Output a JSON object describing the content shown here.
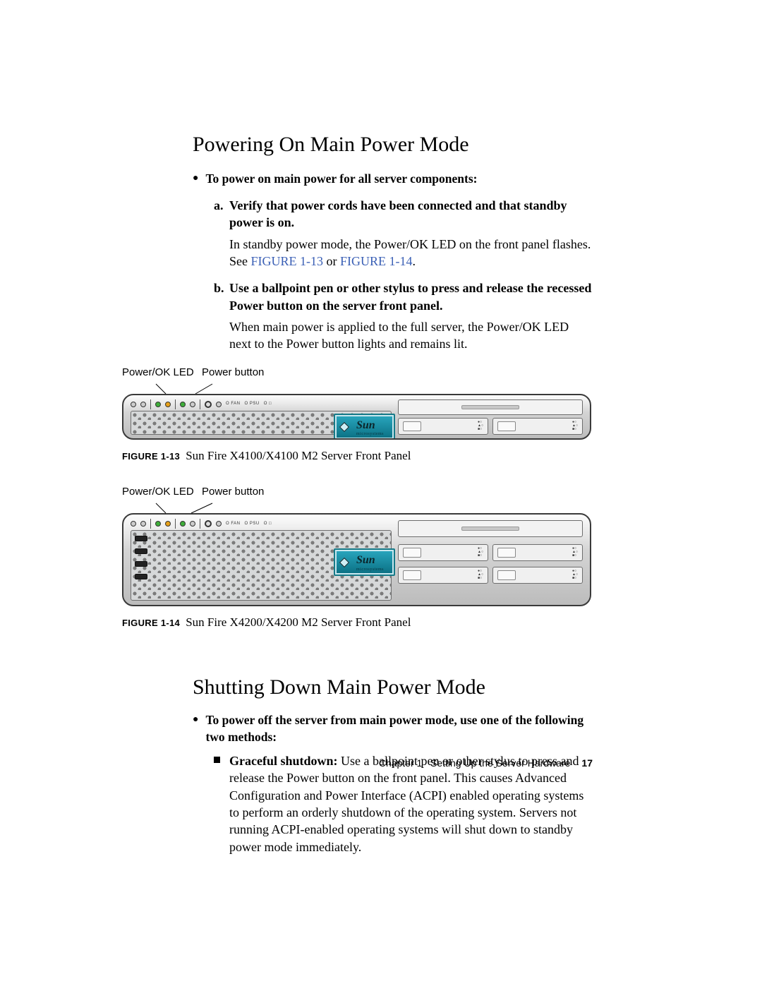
{
  "section1": {
    "title": "Powering On Main Power Mode",
    "lead": "To power on main power for all server components:",
    "steps": [
      {
        "marker": "a.",
        "title": "Verify that power cords have been connected and that standby power is on.",
        "body_pre": "In standby power mode, the Power/OK LED on the front panel flashes. See ",
        "link1": "FIGURE 1-13",
        "mid": " or ",
        "link2": "FIGURE 1-14",
        "post": "."
      },
      {
        "marker": "b.",
        "title": "Use a ballpoint pen or other stylus to press and release the recessed Power button on the server front panel.",
        "body": "When main power is applied to the full server, the Power/OK LED next to the Power button lights and remains lit."
      }
    ]
  },
  "figure13": {
    "callout_led": "Power/OK LED",
    "callout_btn": "Power button",
    "badge": "Sun",
    "badge_sub": "microsystems",
    "caption_ref": "FIGURE 1-13",
    "caption_title": "Sun Fire X4100/X4100 M2 Server Front Panel"
  },
  "figure14": {
    "callout_led": "Power/OK LED",
    "callout_btn": "Power button",
    "badge": "Sun",
    "badge_sub": "microsystems",
    "caption_ref": "FIGURE 1-14",
    "caption_title": "Sun Fire X4200/X4200 M2 Server Front Panel"
  },
  "section2": {
    "title": "Shutting Down Main Power Mode",
    "lead": "To power off the server from main power mode, use one of the following two methods:",
    "item_lead": "Graceful shutdown:",
    "item_body": " Use a ballpoint pen or other stylus to press and release the Power button on the front panel. This causes Advanced Configuration and Power Interface (ACPI) enabled operating systems to perform an orderly shutdown of the operating system. Servers not running ACPI-enabled operating systems will shut down to standby power mode immediately."
  },
  "footer": {
    "chapter": "Chapter 1",
    "title": "Setting Up the Server Hardware",
    "page": "17"
  }
}
